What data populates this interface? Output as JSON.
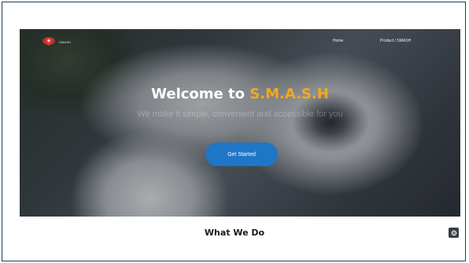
{
  "nav": {
    "logo_text": "SMASH",
    "links": [
      "Home",
      "Product / SMASH"
    ]
  },
  "hero": {
    "title_prefix": "Welcome to ",
    "title_brand": "S.M.A.S.H",
    "subtitle": "We make it simple, convenient and accessible for you",
    "cta_label": "Get Started"
  },
  "section": {
    "title": "What We Do"
  },
  "icons": {
    "logo": "map-pin-logo",
    "corner": "settings-icon"
  },
  "colors": {
    "brand_accent": "#f3a81c",
    "cta_blue": "#1f76c7"
  }
}
